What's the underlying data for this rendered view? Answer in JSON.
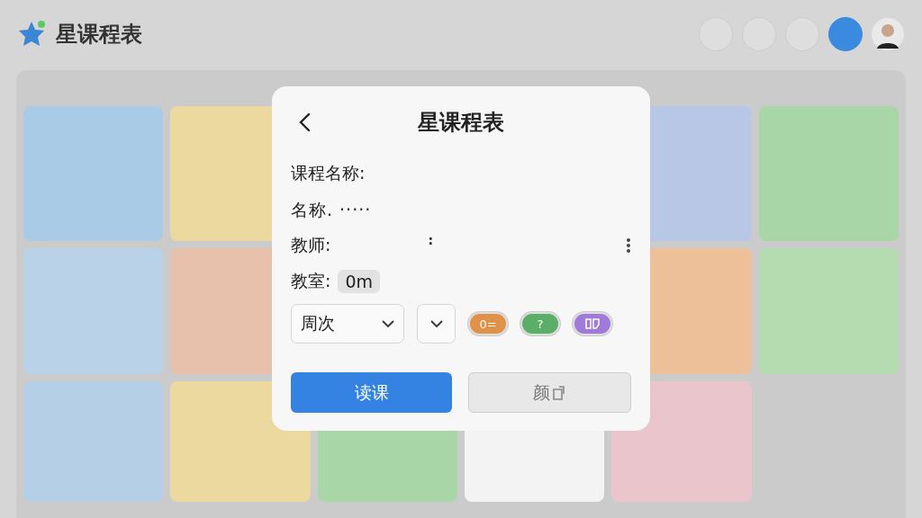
{
  "app": {
    "title": "星课程表"
  },
  "background": {
    "cards": [
      {
        "color": "#a9cbe6"
      },
      {
        "color": "#ecd9a0"
      },
      {
        "color": "#b9c7e6"
      },
      {
        "color": "#a8d6a6"
      },
      {
        "color": "#b9d2e8"
      },
      {
        "color": "#e8c1ad"
      },
      {
        "color": "#edc09a"
      },
      {
        "color": "#b4dcb0"
      },
      {
        "color": "#b5cfe6"
      },
      {
        "color": "#ecd9a0"
      },
      {
        "color": "#a8d6a6"
      },
      {
        "color": "#f3f3f3"
      },
      {
        "color": "#eac6cc"
      }
    ]
  },
  "dialog": {
    "title": "星课程表",
    "fields": [
      {
        "kind": "block",
        "label": "课程名称:",
        "value": "名称. ·····"
      },
      {
        "kind": "menu",
        "label": "教师:",
        "value": ":"
      },
      {
        "kind": "chip",
        "label": "教室:",
        "value": "0m"
      }
    ],
    "week_select": {
      "value": "周次"
    },
    "pills": [
      {
        "kind": "text",
        "color": "#e0914a",
        "label": "0="
      },
      {
        "kind": "text",
        "color": "#5aae68",
        "label": "?"
      },
      {
        "kind": "icon",
        "color": "#a07ad8"
      }
    ],
    "buttons": [
      {
        "label": "读课",
        "disabled": false
      },
      {
        "label": "颜",
        "disabled": true
      }
    ]
  }
}
